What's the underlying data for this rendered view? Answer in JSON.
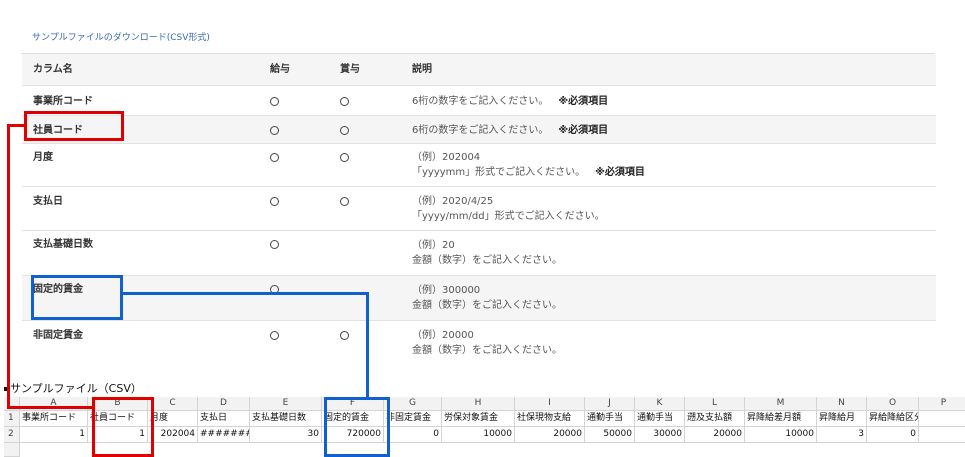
{
  "download_link": "サンプルファイルのダウンロード(CSV形式)",
  "spec_table": {
    "headers": {
      "column": "カラム名",
      "kyuyo": "給与",
      "shoyo": "賞与",
      "description": "説明"
    },
    "rows": [
      {
        "name": "事業所コード",
        "kyuyo": "○",
        "shoyo": "○",
        "desc1": "6桁の数字をご記入ください。",
        "required": "※必須項目",
        "desc2": ""
      },
      {
        "name": "社員コード",
        "kyuyo": "○",
        "shoyo": "○",
        "desc1": "6桁の数字をご記入ください。",
        "required": "※必須項目",
        "desc2": ""
      },
      {
        "name": "月度",
        "kyuyo": "○",
        "shoyo": "○",
        "desc1": "（例）202004",
        "required": "※必須項目",
        "desc2": "「yyyymm」形式でご記入ください。"
      },
      {
        "name": "支払日",
        "kyuyo": "○",
        "shoyo": "○",
        "desc1": "（例）2020/4/25",
        "required": "",
        "desc2": "「yyyy/mm/dd」形式でご記入ください。"
      },
      {
        "name": "支払基礎日数",
        "kyuyo": "○",
        "shoyo": "",
        "desc1": "（例）20",
        "required": "",
        "desc2": "金額（数字）をご記入ください。"
      },
      {
        "name": "固定的賃金",
        "kyuyo": "○",
        "shoyo": "",
        "desc1": "（例）300000",
        "required": "",
        "desc2": "金額（数字）をご記入ください。"
      },
      {
        "name": "非固定賃金",
        "kyuyo": "○",
        "shoyo": "○",
        "desc1": "（例）20000",
        "required": "",
        "desc2": "金額（数字）をご記入ください。"
      }
    ]
  },
  "sample_title": "サンプルファイル（CSV）",
  "sheet": {
    "col_letters": [
      "A",
      "B",
      "C",
      "D",
      "E",
      "F",
      "G",
      "H",
      "I",
      "J",
      "K",
      "L",
      "M",
      "N",
      "O",
      "P"
    ],
    "row_numbers": [
      "1",
      "2"
    ],
    "row1": [
      "事業所コード",
      "社員コード",
      "月度",
      "支払日",
      "支払基礎日数",
      "固定的賃金",
      "非固定賃金",
      "労保対象賃金",
      "社保現物支給",
      "通勤手当",
      "通勤手当",
      "遡及支払額",
      "昇降給差月額",
      "昇降給月",
      "昇給降給区分",
      ""
    ],
    "row2": [
      "1",
      "1",
      "202004",
      "########",
      "30",
      "720000",
      "0",
      "10000",
      "20000",
      "50000",
      "30000",
      "20000",
      "10000",
      "3",
      "0",
      ""
    ]
  }
}
